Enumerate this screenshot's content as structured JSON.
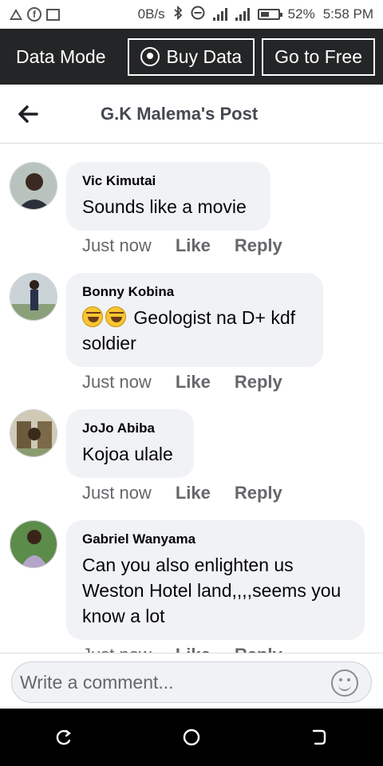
{
  "statusbar": {
    "network_speed": "0B/s",
    "battery": "52%",
    "battery_level": 0.52,
    "time": "5:58 PM",
    "icons": [
      "warning-icon",
      "facebook-icon",
      "image-icon",
      "bluetooth-icon",
      "do-not-disturb-icon",
      "signal-icon",
      "signal-icon",
      "battery-icon"
    ]
  },
  "databar": {
    "mode_label": "Data Mode",
    "buy_label": "Buy Data",
    "free_label": "Go to Free"
  },
  "header": {
    "title": "G.K Malema's Post"
  },
  "comments": [
    {
      "author": "Vic Kimutai",
      "text": "Sounds like a movie",
      "time": "Just now",
      "like": "Like",
      "reply": "Reply"
    },
    {
      "author": "Bonny Kobina",
      "emoji": [
        "rofl-emoji",
        "rofl-emoji"
      ],
      "text": "Geologist na D+ kdf soldier",
      "time": "Just now",
      "like": "Like",
      "reply": "Reply"
    },
    {
      "author": "JoJo Abiba",
      "text": "Kojoa ulale",
      "time": "Just now",
      "like": "Like",
      "reply": "Reply"
    },
    {
      "author": "Gabriel Wanyama",
      "text": "Can you also enlighten us Weston Hotel land,,,,seems you know a lot",
      "time": "Just now",
      "like": "Like",
      "reply": "Reply"
    }
  ],
  "composer": {
    "placeholder": "Write a comment..."
  },
  "colors": {
    "databar_bg": "#242526",
    "bubble_bg": "#f0f2f5",
    "navbar_bg": "#000000"
  }
}
